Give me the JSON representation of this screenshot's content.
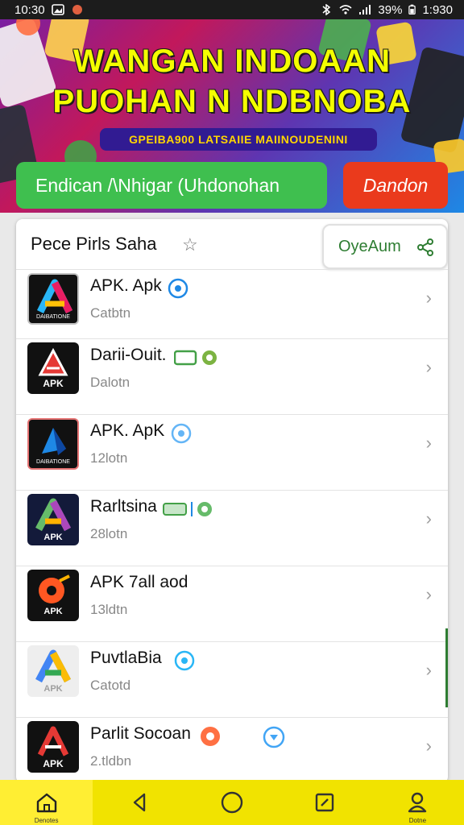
{
  "status_bar": {
    "time_left": "10:30",
    "battery": "39%",
    "time_right": "1:930"
  },
  "banner": {
    "title_line1": "WANGAN INDOAAN",
    "title_line2": "PUOHAN N NDBNOBA",
    "subtitle": "GPEIBA900 LATSAIIE MAIINOUDENINI",
    "primary_button": "Endican /\\Nhigar (Uhdonohan",
    "secondary_button": "Dandon"
  },
  "list_header": {
    "title": "Pece Pirls Saha",
    "action_label": "OyeAum"
  },
  "apps": [
    {
      "name": "APK. Apk",
      "sub": "Catbtn",
      "badge": "blue-circle",
      "icon_label": "DAIBATIONE",
      "icon_letter": "A",
      "icon_bg": "#111111"
    },
    {
      "name": "Darii-Ouit.",
      "sub": "Dalotn",
      "badge": "green-tags",
      "icon_label": "APK",
      "icon_letter": "A",
      "icon_bg": "#111111"
    },
    {
      "name": "APK. ApK",
      "sub": "12lotn",
      "badge": "blue-circle",
      "icon_label": "DAIBATIONE",
      "icon_letter": "A",
      "icon_bg": "#111111"
    },
    {
      "name": "Rarltsina",
      "sub": "28lotn",
      "badge": "green-tags",
      "icon_label": "APK",
      "icon_letter": "A",
      "icon_bg": "#131a3a"
    },
    {
      "name": "APK 7all aod",
      "sub": "13ldtn",
      "badge": "none",
      "icon_label": "APK",
      "icon_letter": "A",
      "icon_bg": "#111111"
    },
    {
      "name": "PuvtlaBia",
      "sub": "Catotd",
      "badge": "blue-circle",
      "icon_label": "APK",
      "icon_letter": "A",
      "icon_bg": "#eeeeee"
    },
    {
      "name": "Parlit Socoan",
      "sub": "2.tldbn",
      "badge": "orange-blue",
      "icon_label": "APK",
      "icon_letter": "A",
      "icon_bg": "#111111"
    }
  ],
  "bottom_nav": [
    {
      "icon": "home-icon",
      "label": "Denotes"
    },
    {
      "icon": "back-icon",
      "label": ""
    },
    {
      "icon": "circle-home-icon",
      "label": ""
    },
    {
      "icon": "edit-icon",
      "label": ""
    },
    {
      "icon": "profile-icon",
      "label": "Dotne"
    }
  ]
}
